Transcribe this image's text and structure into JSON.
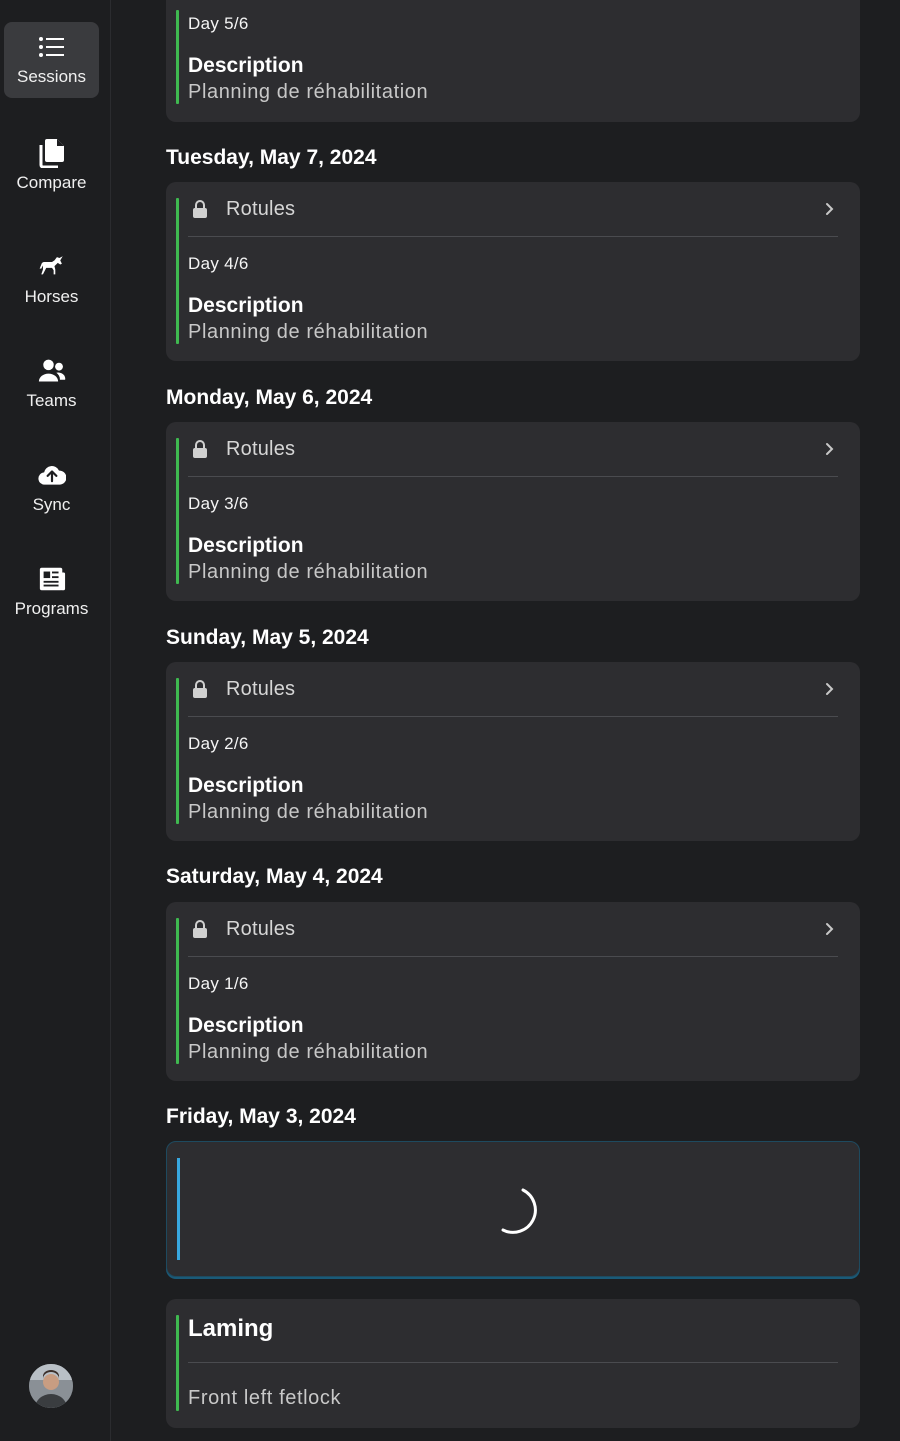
{
  "sidebar": {
    "items": [
      {
        "label": "Sessions",
        "icon": "list-icon",
        "active": true
      },
      {
        "label": "Compare",
        "icon": "documents-icon"
      },
      {
        "label": "Horses",
        "icon": "horse-icon"
      },
      {
        "label": "Teams",
        "icon": "users-icon"
      },
      {
        "label": "Sync",
        "icon": "cloud-upload-icon"
      },
      {
        "label": "Programs",
        "icon": "newspaper-icon"
      }
    ],
    "avatar": "user-avatar"
  },
  "sessions": {
    "top_card": {
      "day": "Day 5/6",
      "description_label": "Description",
      "description": "Planning de réhabilitation"
    },
    "groups": [
      {
        "date": "Tuesday, May 7, 2024",
        "title": "Rotules",
        "day": "Day 4/6",
        "description_label": "Description",
        "description": "Planning de réhabilitation"
      },
      {
        "date": "Monday, May 6, 2024",
        "title": "Rotules",
        "day": "Day 3/6",
        "description_label": "Description",
        "description": "Planning de réhabilitation"
      },
      {
        "date": "Sunday, May 5, 2024",
        "title": "Rotules",
        "day": "Day 2/6",
        "description_label": "Description",
        "description": "Planning de réhabilitation"
      },
      {
        "date": "Saturday, May 4, 2024",
        "title": "Rotules",
        "day": "Day 1/6",
        "description_label": "Description",
        "description": "Planning de réhabilitation"
      }
    ],
    "friday": {
      "date": "Friday, May 3, 2024",
      "laming_title": "Laming",
      "laming_text": "Front left fetlock"
    }
  },
  "colors": {
    "accent_green": "#3fb950",
    "accent_blue": "#38a8e0",
    "card_bg": "#2d2d30",
    "page_bg": "#1d1e20"
  }
}
